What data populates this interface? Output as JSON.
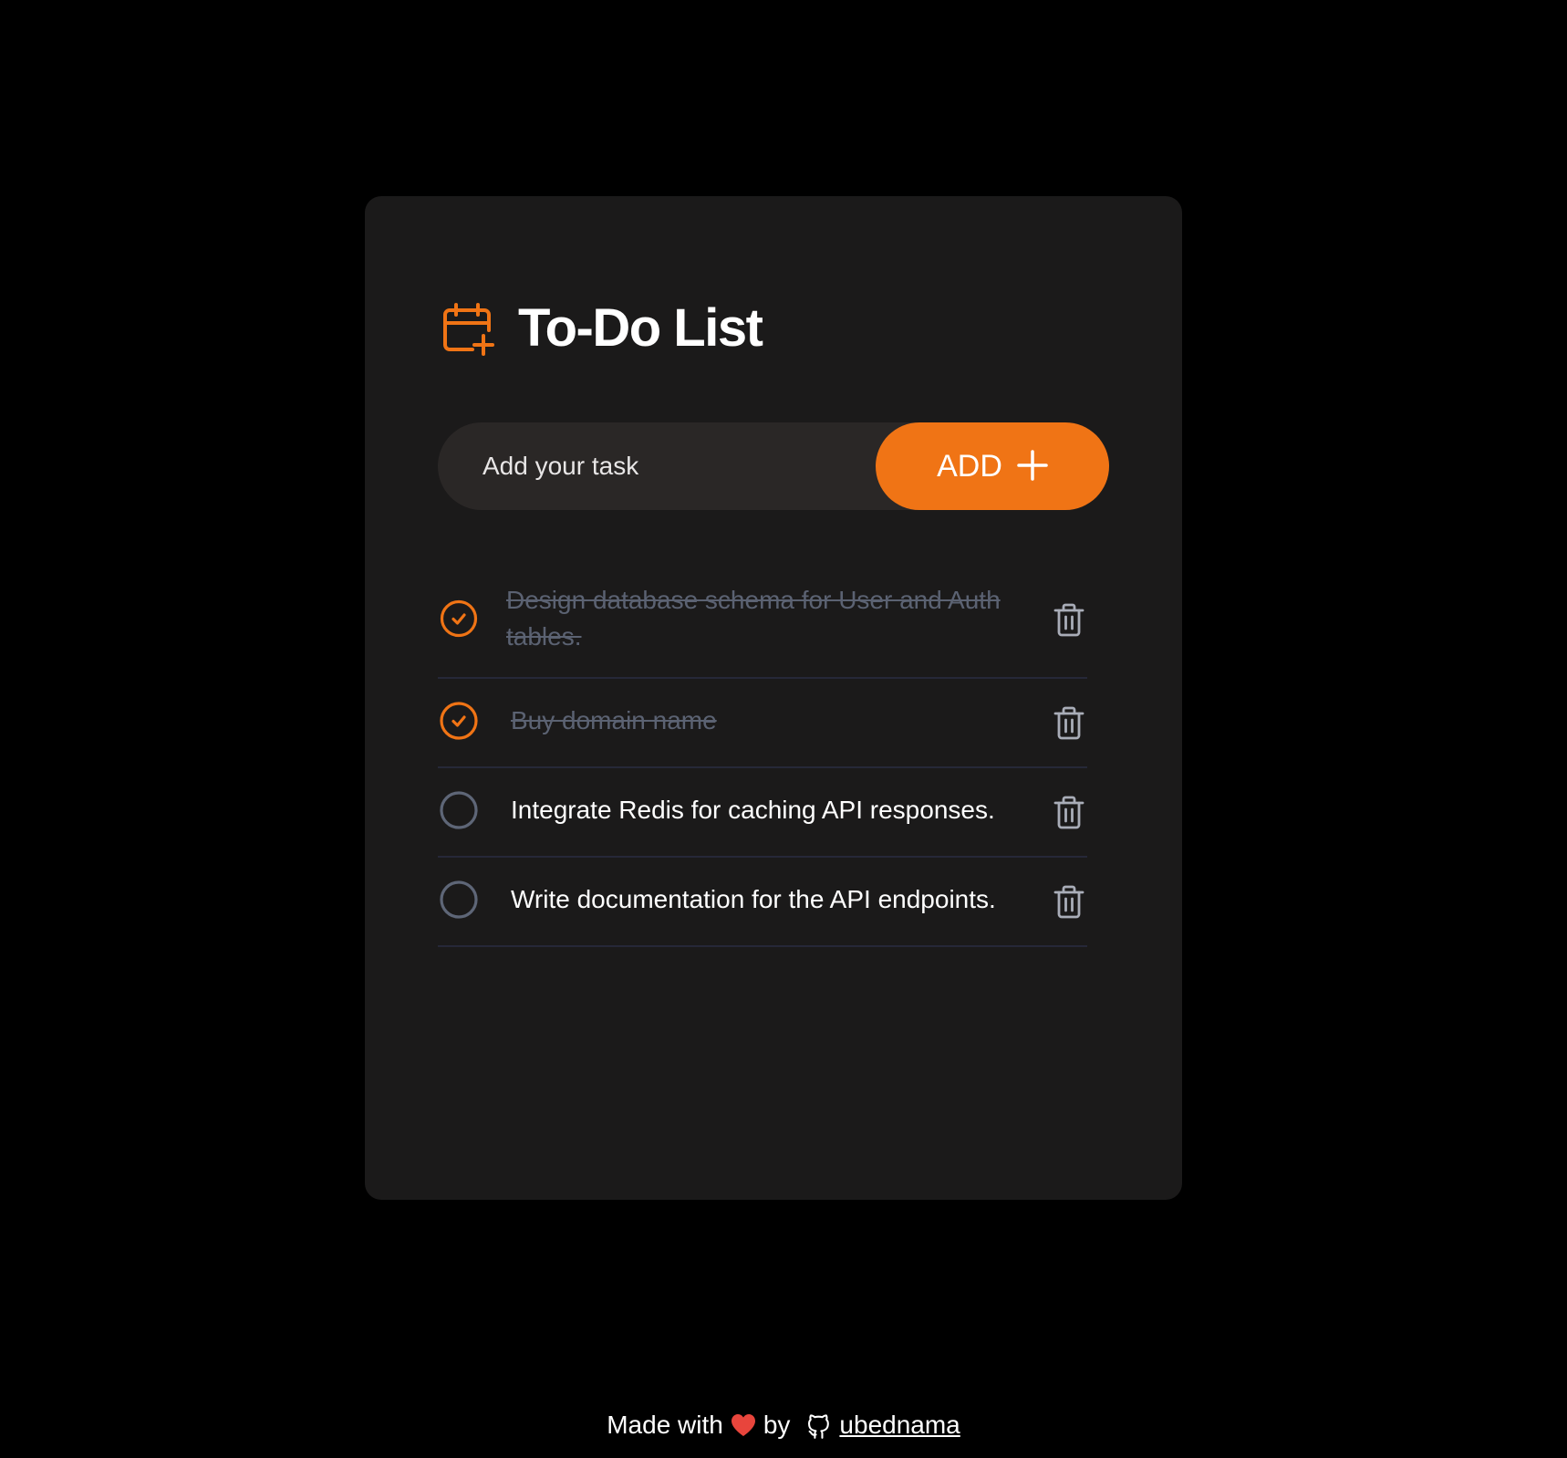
{
  "app": {
    "title": "To-Do List",
    "accent_color": "#f07415",
    "card_color": "#1b1a1a",
    "background_color": "#000000"
  },
  "header": {
    "icon": "calendar-plus-icon",
    "title": "To-Do List"
  },
  "new_task": {
    "placeholder": "Add your task",
    "value": "",
    "button_label": "ADD",
    "button_icon": "plus-icon"
  },
  "tasks": [
    {
      "text": "Design database schema for User and Auth tables.",
      "completed": true
    },
    {
      "text": "Buy domain name",
      "completed": true
    },
    {
      "text": "Integrate Redis for caching API responses.",
      "completed": false
    },
    {
      "text": "Write documentation for the API endpoints.",
      "completed": false
    }
  ],
  "task_icons": {
    "checked": "check-circle-icon",
    "unchecked": "empty-circle-icon",
    "delete": "trash-icon"
  },
  "footer": {
    "made_with": "Made with",
    "heart_icon": "heart-icon",
    "by": "by",
    "github_icon": "github-icon",
    "author": "ubednama"
  }
}
